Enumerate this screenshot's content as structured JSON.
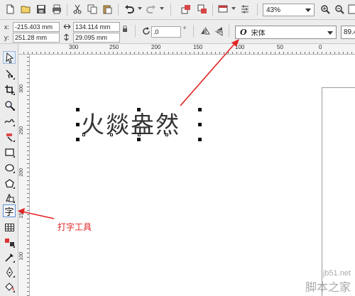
{
  "toolbar": {
    "icons": [
      "new-icon",
      "open-icon",
      "save-icon",
      "print-icon",
      "cut-icon",
      "copy-icon",
      "paste-icon",
      "undo-icon",
      "redo-icon",
      "import-icon",
      "export-icon",
      "launcher-icon",
      "options-icon"
    ],
    "zoom_value": "43%"
  },
  "property_bar": {
    "x_label": "x:",
    "x_value": "-215.403 mm",
    "y_label": "y:",
    "y_value": "251.28 mm",
    "width_value": "134.114 mm",
    "height_value": "29.095 mm",
    "rotation_value": ".0",
    "rotation_unit": "°",
    "font_name": "宋体",
    "font_size": "89.4"
  },
  "ruler": {
    "top_labels": [
      "300",
      "250",
      "200",
      "150",
      "100",
      "50",
      "0"
    ],
    "left_labels": [
      "300",
      "250",
      "200",
      "150",
      "100"
    ]
  },
  "canvas": {
    "sample_text": "火燚盎然",
    "annotation_label": "打字工具"
  },
  "toolbox": {
    "text_tool_glyph": "字"
  },
  "watermark": {
    "url": "jb51.net",
    "name": "脚本之家"
  },
  "colors": {
    "annotation_red": "#e22424",
    "selection_blue": "#5b8fd8"
  }
}
